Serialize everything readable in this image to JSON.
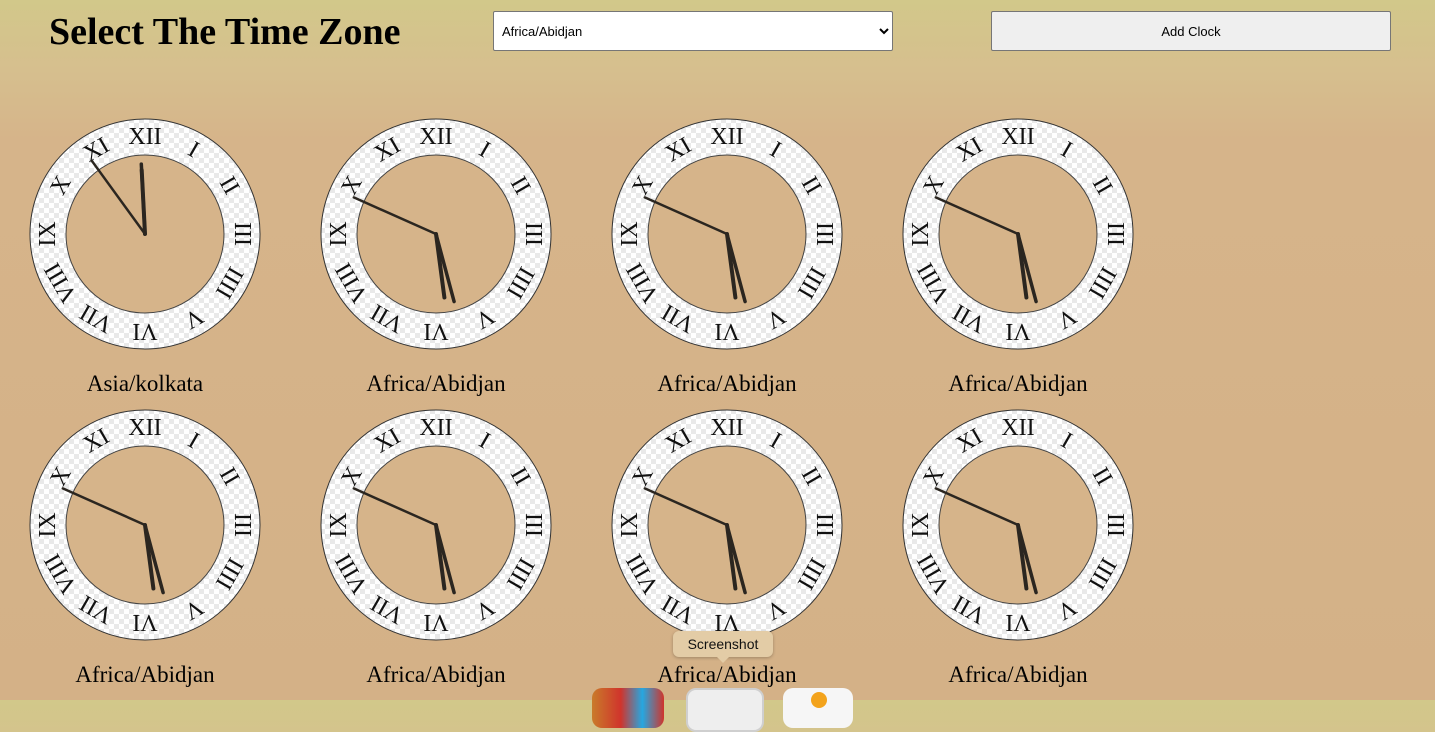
{
  "header": {
    "title": "Select The Time Zone",
    "select_value": "Africa/Abidjan",
    "add_button_label": "Add Clock"
  },
  "clock_numerals": [
    "XII",
    "I",
    "II",
    "III",
    "IIII",
    "V",
    "VI",
    "VII",
    "VIII",
    "IX",
    "X",
    "XI"
  ],
  "clocks": [
    {
      "label": "Asia/kolkata",
      "hour": 11.9,
      "minute": 59.5,
      "second": 54
    },
    {
      "label": "Africa/Abidjan",
      "hour": 5.75,
      "minute": 27.5,
      "second": 49
    },
    {
      "label": "Africa/Abidjan",
      "hour": 5.75,
      "minute": 27.5,
      "second": 49
    },
    {
      "label": "Africa/Abidjan",
      "hour": 5.75,
      "minute": 27.5,
      "second": 49
    },
    {
      "label": "Africa/Abidjan",
      "hour": 5.75,
      "minute": 27.5,
      "second": 49
    },
    {
      "label": "Africa/Abidjan",
      "hour": 5.75,
      "minute": 27.5,
      "second": 49
    },
    {
      "label": "Africa/Abidjan",
      "hour": 5.75,
      "minute": 27.5,
      "second": 49
    },
    {
      "label": "Africa/Abidjan",
      "hour": 5.75,
      "minute": 27.5,
      "second": 49
    }
  ],
  "tooltip": {
    "text": "Screenshot"
  },
  "dock": [
    {
      "icon": "app-icon",
      "color": "#c0392b"
    },
    {
      "icon": "screenshot-icon",
      "color": "#e8e8e8"
    },
    {
      "icon": "app-icon",
      "color": "#f5f5f5"
    }
  ]
}
